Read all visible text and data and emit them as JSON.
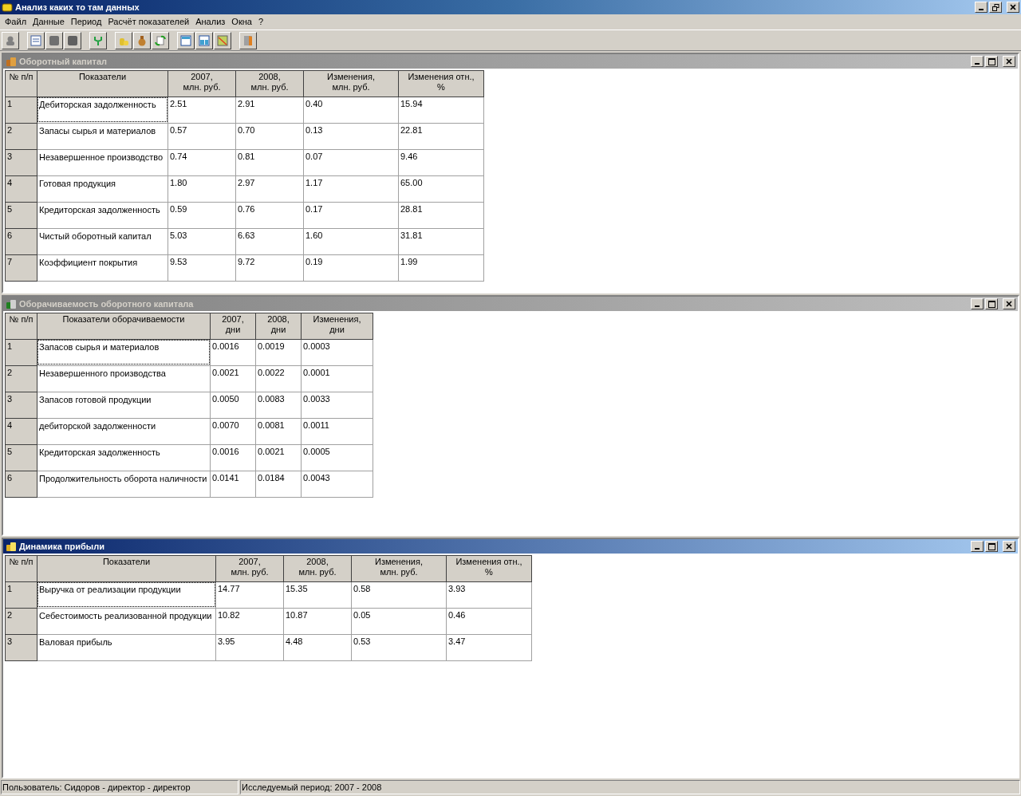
{
  "window": {
    "title": "Анализ каких то там данных"
  },
  "menu": [
    "Файл",
    "Данные",
    "Период",
    "Расчёт показателей",
    "Анализ",
    "Окна",
    "?"
  ],
  "child_windows": [
    {
      "title": "Оборотный капитал",
      "active": false,
      "columns": [
        "№ п/п",
        "Показатели",
        "2007,\nмлн. руб.",
        "2008,\nмлн. руб.",
        "Изменения,\nмлн. руб.",
        "Изменения отн.,\n%"
      ],
      "rows": [
        {
          "focused": true,
          "cells": [
            "1",
            "Дебиторская задолженность",
            "2.51",
            "2.91",
            "0.40",
            "15.94"
          ]
        },
        {
          "focused": false,
          "cells": [
            "2",
            "Запасы сырья и материалов",
            "0.57",
            "0.70",
            "0.13",
            "22.81"
          ]
        },
        {
          "focused": false,
          "cells": [
            "3",
            "Незавершенное производство",
            "0.74",
            "0.81",
            "0.07",
            "9.46"
          ]
        },
        {
          "focused": false,
          "cells": [
            "4",
            "Готовая продукция",
            "1.80",
            "2.97",
            "1.17",
            "65.00"
          ]
        },
        {
          "focused": false,
          "cells": [
            "5",
            "Кредиторская задолженность",
            "0.59",
            "0.76",
            "0.17",
            "28.81"
          ]
        },
        {
          "focused": false,
          "cells": [
            "6",
            "Чистый оборотный капитал",
            "5.03",
            "6.63",
            "1.60",
            "31.81"
          ]
        },
        {
          "focused": false,
          "cells": [
            "7",
            "Коэффициент покрытия",
            "9.53",
            "9.72",
            "0.19",
            "1.99"
          ]
        }
      ]
    },
    {
      "title": "Оборачиваемость оборотного капитала",
      "active": false,
      "columns": [
        "№ п/п",
        "Показатели оборачиваемости",
        "2007,\nдни",
        "2008,\nдни",
        "Изменения,\nдни"
      ],
      "rows": [
        {
          "focused": true,
          "cells": [
            "1",
            "Запасов сырья и материалов",
            "0.0016",
            "0.0019",
            "0.0003"
          ]
        },
        {
          "focused": false,
          "cells": [
            "2",
            "Незавершенного производства",
            "0.0021",
            "0.0022",
            "0.0001"
          ]
        },
        {
          "focused": false,
          "cells": [
            "3",
            "Запасов готовой продукции",
            "0.0050",
            "0.0083",
            "0.0033"
          ]
        },
        {
          "focused": false,
          "cells": [
            "4",
            "дебиторской задолженности",
            "0.0070",
            "0.0081",
            "0.0011"
          ]
        },
        {
          "focused": false,
          "cells": [
            "5",
            "Кредиторская задолженность",
            "0.0016",
            "0.0021",
            "0.0005"
          ]
        },
        {
          "focused": false,
          "cells": [
            "6",
            "Продолжительность оборота наличности",
            "0.0141",
            "0.0184",
            "0.0043"
          ]
        }
      ]
    },
    {
      "title": "Динамика прибыли",
      "active": true,
      "columns": [
        "№ п/п",
        "Показатели",
        "2007,\nмлн. руб.",
        "2008,\nмлн. руб.",
        "Изменения,\nмлн. руб.",
        "Изменения отн.,\n%"
      ],
      "rows": [
        {
          "focused": true,
          "cells": [
            "1",
            "Выручка от реализации продукции",
            "14.77",
            "15.35",
            "0.58",
            "3.93"
          ]
        },
        {
          "focused": false,
          "cells": [
            "2",
            "Себестоимость реализованной продукции",
            "10.82",
            "10.87",
            "0.05",
            "0.46"
          ]
        },
        {
          "focused": false,
          "cells": [
            "3",
            "Валовая прибыль",
            "3.95",
            "4.48",
            "0.53",
            "3.47"
          ]
        }
      ]
    }
  ],
  "status_bar": [
    "Пользователь: Сидоров - директор - директор",
    "Исследуемый период: 2007 - 2008"
  ]
}
